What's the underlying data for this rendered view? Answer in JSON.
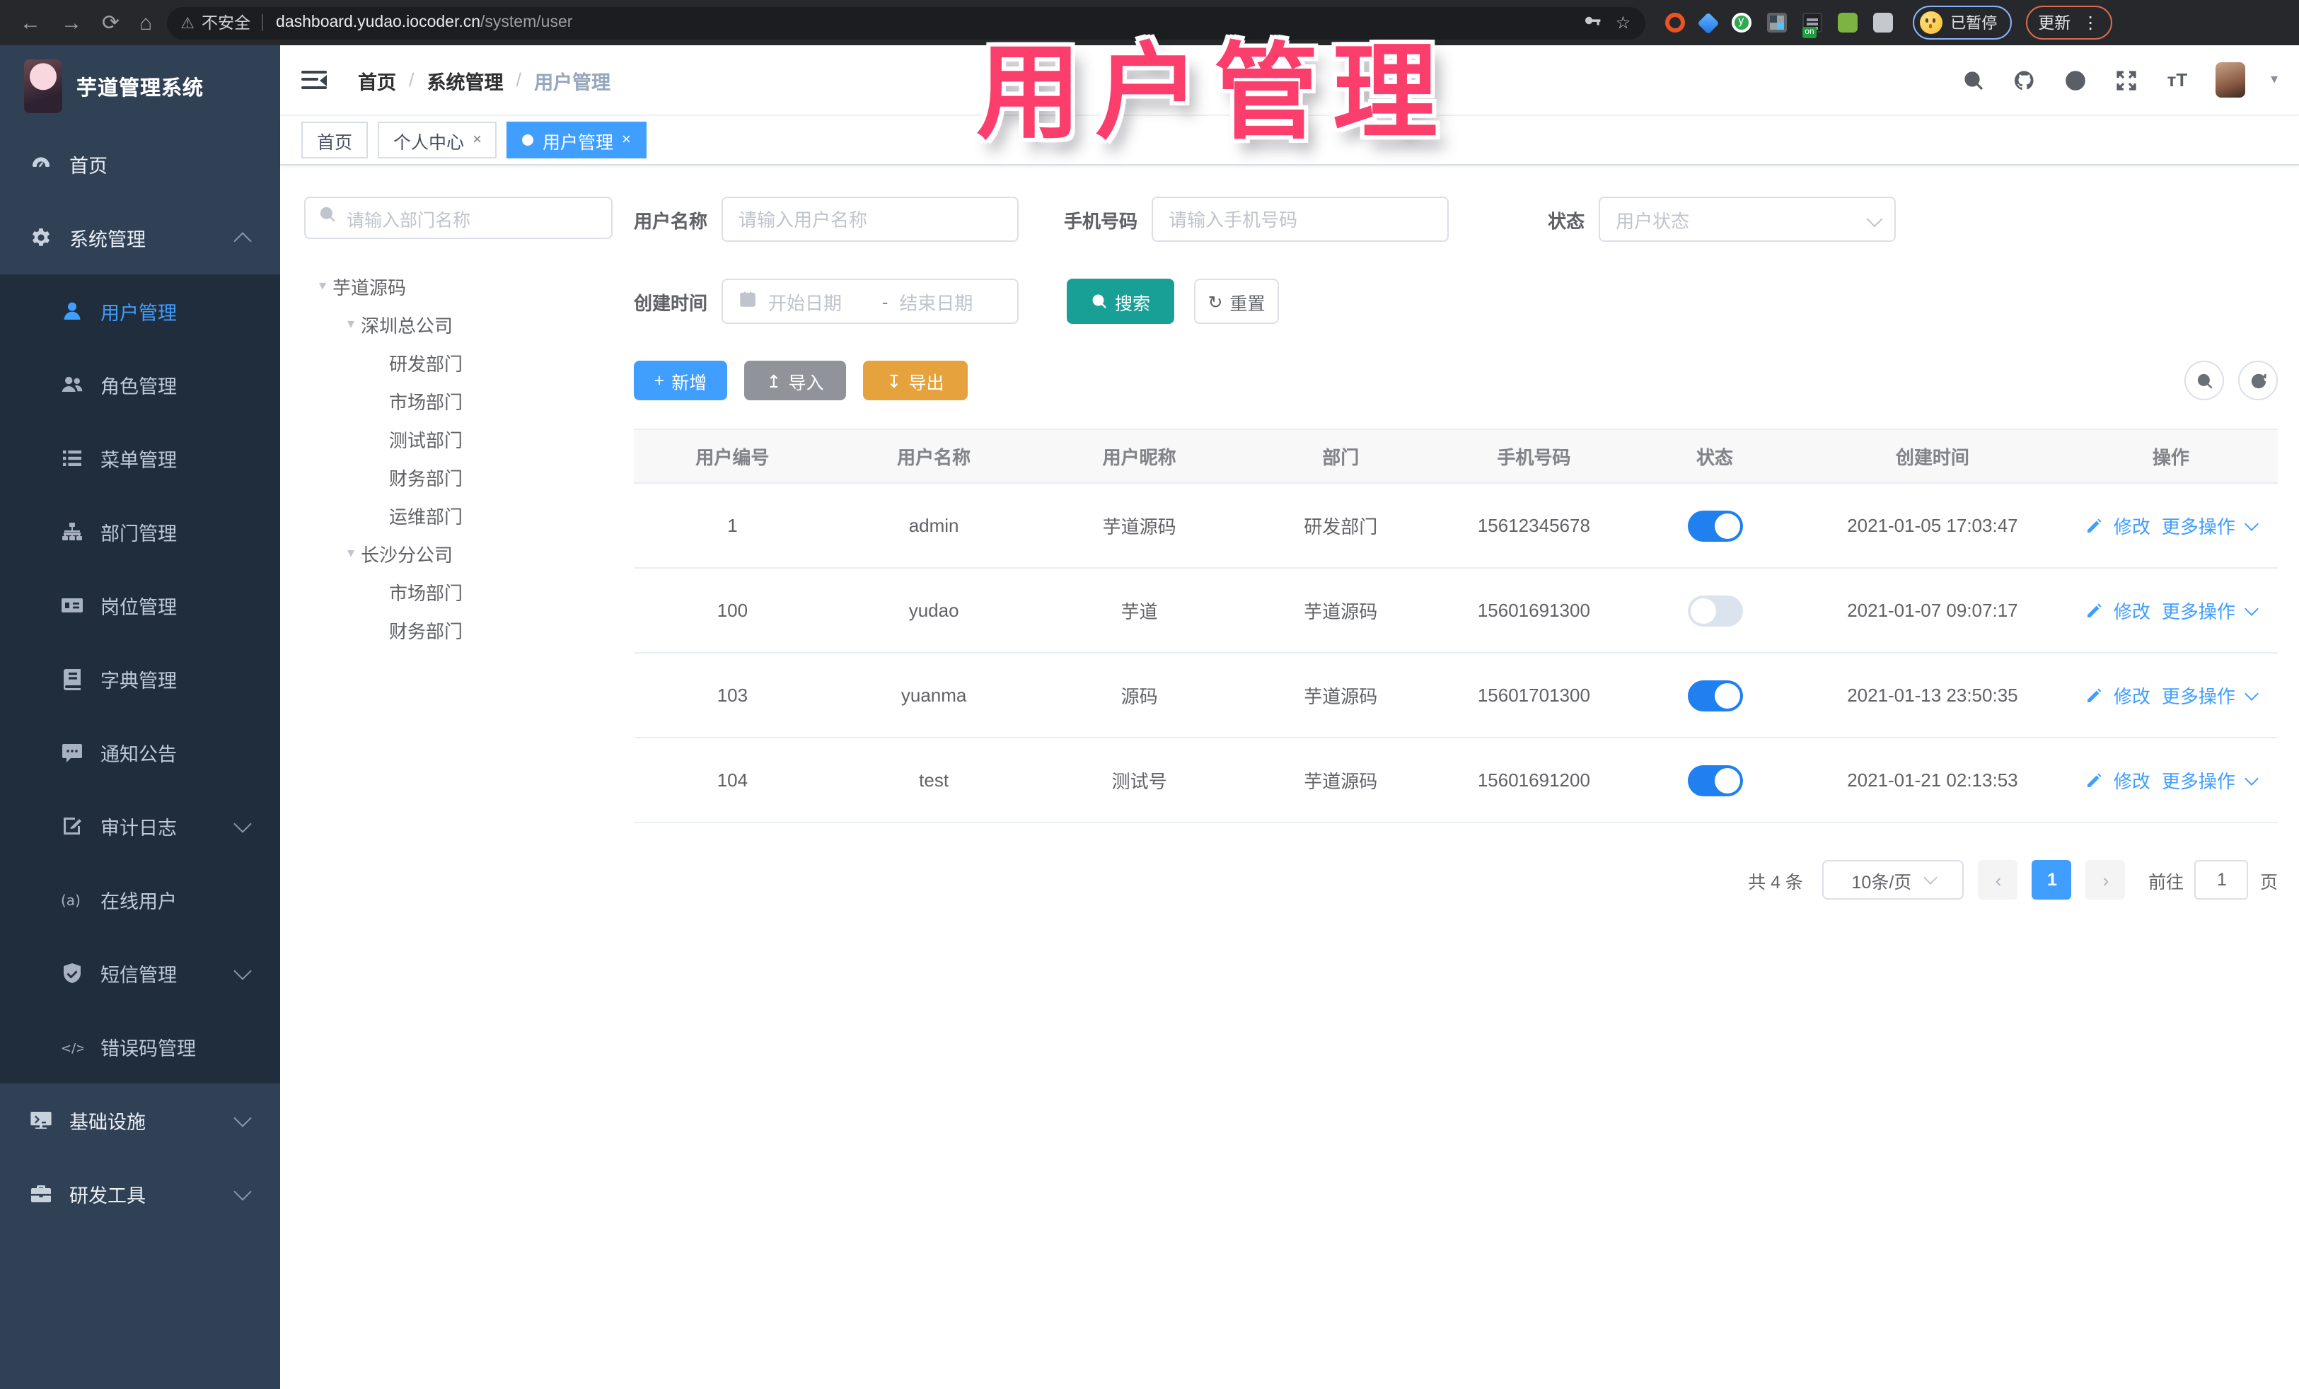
{
  "browser": {
    "security_label": "不安全",
    "url_host": "dashboard.yudao.iocoder.cn",
    "url_path": "/system/user",
    "profile_badge": "已暂停",
    "update_button": "更新"
  },
  "glyphs": {
    "back": "←",
    "forward": "→",
    "reload": "⟳",
    "home": "⌂",
    "warning": "⚠",
    "key": "⚿",
    "star": "☆",
    "dots": "⋮",
    "caret_down": "▾",
    "tree_caret": "▾",
    "breadcrumb_sep": "/",
    "close": "×",
    "range_sep": "-",
    "upload": "↥",
    "download": "↧",
    "reset": "↻",
    "plus": "+",
    "prev": "‹",
    "next": "›",
    "font_size_icon": "тT"
  },
  "watermark": "用户管理",
  "sidebar": {
    "app_title": "芋道管理系统",
    "items": [
      {
        "label": "首页"
      },
      {
        "label": "系统管理"
      },
      {
        "label": "用户管理"
      },
      {
        "label": "角色管理"
      },
      {
        "label": "菜单管理"
      },
      {
        "label": "部门管理"
      },
      {
        "label": "岗位管理"
      },
      {
        "label": "字典管理"
      },
      {
        "label": "通知公告"
      },
      {
        "label": "审计日志"
      },
      {
        "label": "在线用户"
      },
      {
        "label": "短信管理"
      },
      {
        "label": "错误码管理"
      },
      {
        "label": "基础设施"
      },
      {
        "label": "研发工具"
      }
    ]
  },
  "header": {
    "breadcrumb": [
      "首页",
      "系统管理",
      "用户管理"
    ]
  },
  "tabs": [
    {
      "label": "首页"
    },
    {
      "label": "个人中心"
    },
    {
      "label": "用户管理"
    }
  ],
  "dept_tree": {
    "search_placeholder": "请输入部门名称",
    "nodes": [
      {
        "label": "芋道源码",
        "level": 0
      },
      {
        "label": "深圳总公司",
        "level": 1
      },
      {
        "label": "研发部门",
        "level": 2
      },
      {
        "label": "市场部门",
        "level": 2
      },
      {
        "label": "测试部门",
        "level": 2
      },
      {
        "label": "财务部门",
        "level": 2
      },
      {
        "label": "运维部门",
        "level": 2
      },
      {
        "label": "长沙分公司",
        "level": 1
      },
      {
        "label": "市场部门",
        "level": 2
      },
      {
        "label": "财务部门",
        "level": 2
      }
    ]
  },
  "filters": {
    "user_name_label": "用户名称",
    "user_name_placeholder": "请输入用户名称",
    "mobile_label": "手机号码",
    "mobile_placeholder": "请输入手机号码",
    "status_label": "状态",
    "status_placeholder": "用户状态",
    "create_time_label": "创建时间",
    "date_start_placeholder": "开始日期",
    "date_end_placeholder": "结束日期",
    "search_button": "搜索",
    "reset_button": "重置"
  },
  "toolbar": {
    "add_label": "新增",
    "import_label": "导入",
    "export_label": "导出"
  },
  "table": {
    "columns": [
      "用户编号",
      "用户名称",
      "用户昵称",
      "部门",
      "手机号码",
      "状态",
      "创建时间",
      "操作"
    ],
    "edit_label": "修改",
    "more_label": "更多操作",
    "rows": [
      {
        "id": "1",
        "username": "admin",
        "nickname": "芋道源码",
        "dept": "研发部门",
        "mobile": "15612345678",
        "status": true,
        "created": "2021-01-05 17:03:47"
      },
      {
        "id": "100",
        "username": "yudao",
        "nickname": "芋道",
        "dept": "芋道源码",
        "mobile": "15601691300",
        "status": false,
        "created": "2021-01-07 09:07:17"
      },
      {
        "id": "103",
        "username": "yuanma",
        "nickname": "源码",
        "dept": "芋道源码",
        "mobile": "15601701300",
        "status": true,
        "created": "2021-01-13 23:50:35"
      },
      {
        "id": "104",
        "username": "test",
        "nickname": "测试号",
        "dept": "芋道源码",
        "mobile": "15601691200",
        "status": true,
        "created": "2021-01-21 02:13:53"
      }
    ]
  },
  "pagination": {
    "total_text": "共 4 条",
    "page_size_text": "10条/页",
    "current_page": "1",
    "goto_label": "前往",
    "goto_value": "1",
    "page_unit": "页"
  }
}
